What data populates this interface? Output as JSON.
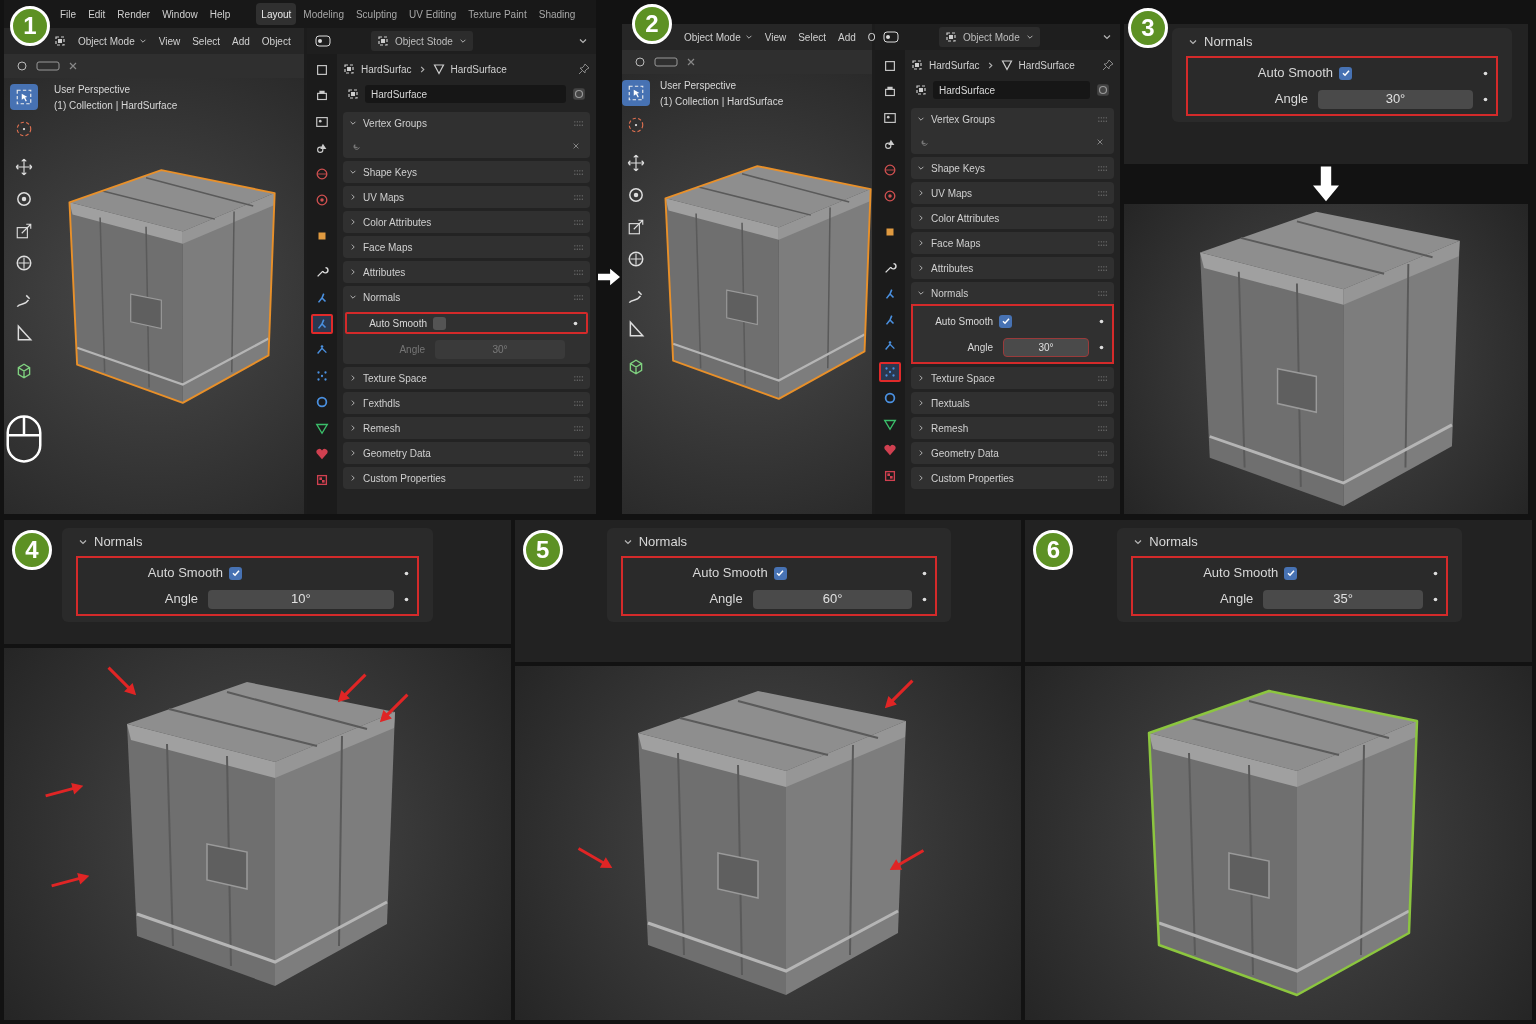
{
  "steps": [
    {
      "kind": "editor",
      "badge": "1",
      "transition_arrow": true,
      "menu": [
        "File",
        "Edit",
        "Render",
        "Window",
        "Help"
      ],
      "workspaces": [
        {
          "label": "Layout",
          "selected": true
        },
        {
          "label": "Modeling",
          "selected": false
        },
        {
          "label": "Sculpting",
          "selected": false
        },
        {
          "label": "UV Editing",
          "selected": false
        },
        {
          "label": "Texture Paint",
          "selected": false
        },
        {
          "label": "Shading",
          "selected": false
        }
      ],
      "viewport": {
        "header": [
          "Object Mode",
          "View",
          "Select",
          "Add",
          "Object"
        ],
        "overlay": [
          "User Perspective",
          "(1) Collection | HardSurface"
        ],
        "tools": [
          {
            "selected": true
          },
          {
            "selected": false
          },
          {
            "selected": false
          },
          {
            "selected": false
          },
          {
            "selected": false
          },
          {
            "selected": false
          },
          {
            "selected": false
          },
          {
            "selected": false
          },
          {
            "selected": false
          }
        ],
        "selection_outline": {
          "color": "#e8902a"
        },
        "mouse_hint": true
      },
      "properties": {
        "header": "Object Stode",
        "breadcrumb": [
          "HardSurfac",
          "HardSurface"
        ],
        "object_name": "HardSurface",
        "tabs": [
          {
            "selected": false
          },
          {
            "selected": false
          },
          {
            "selected": false
          },
          {
            "selected": false
          },
          {
            "selected": false
          },
          {
            "selected": false
          },
          {
            "selected": false
          },
          {
            "selected": false
          },
          {
            "selected": false
          },
          {
            "selected": true
          },
          {
            "selected": false
          },
          {
            "selected": false
          },
          {
            "selected": false
          },
          {
            "selected": false
          },
          {
            "selected": false
          },
          {
            "selected": false
          }
        ],
        "panels": [
          {
            "kind": "list",
            "label": "Vertex Groups",
            "expanded": true
          },
          {
            "kind": "plain",
            "label": "Shape Keys",
            "expanded": true
          },
          {
            "kind": "plain",
            "label": "UV Maps",
            "expanded": false
          },
          {
            "kind": "plain",
            "label": "Color Attributes",
            "expanded": false
          },
          {
            "kind": "plain",
            "label": "Face Maps",
            "expanded": false
          },
          {
            "kind": "plain",
            "label": "Attributes",
            "expanded": false
          },
          {
            "kind": "normals",
            "label": "Normals",
            "expanded": true,
            "auto_smooth": "Auto Smooth",
            "checked": false,
            "angle_label": "Angle",
            "angle": "30°",
            "highlight": {
              "kind": "row"
            }
          },
          {
            "kind": "plain",
            "label": "Texture Space",
            "expanded": false
          },
          {
            "kind": "plain",
            "label": "Гexthdls",
            "expanded": false
          },
          {
            "kind": "plain",
            "label": "Remesh",
            "expanded": false
          },
          {
            "kind": "plain",
            "label": "Geometry Data",
            "expanded": false
          },
          {
            "kind": "plain",
            "label": "Custom Properties",
            "expanded": false
          }
        ]
      }
    },
    {
      "kind": "editor",
      "badge": "2",
      "viewport": {
        "header": [
          "Object Mode",
          "View",
          "Select",
          "Add",
          "O"
        ],
        "overlay": [
          "User Perspective",
          "(1) Collection | HardSurface"
        ],
        "tools": [
          {
            "selected": true
          },
          {
            "selected": false
          },
          {
            "selected": false
          },
          {
            "selected": false
          },
          {
            "selected": false
          },
          {
            "selected": false
          },
          {
            "selected": false
          },
          {
            "selected": false
          },
          {
            "selected": false
          }
        ],
        "selection_outline": {
          "color": "#e8902a"
        }
      },
      "properties": {
        "header": "Object Mode",
        "breadcrumb": [
          "HardSurfac",
          "HardSurface"
        ],
        "object_name": "HardSurface",
        "tabs": [
          {
            "selected": false
          },
          {
            "selected": false
          },
          {
            "selected": false
          },
          {
            "selected": false
          },
          {
            "selected": false
          },
          {
            "selected": false
          },
          {
            "selected": false
          },
          {
            "selected": false
          },
          {
            "selected": false
          },
          {
            "selected": false
          },
          {
            "selected": false
          },
          {
            "selected": true
          },
          {
            "selected": false
          },
          {
            "selected": false
          },
          {
            "selected": false
          },
          {
            "selected": false
          }
        ],
        "panels": [
          {
            "kind": "list",
            "label": "Vertex Groups",
            "expanded": true
          },
          {
            "kind": "plain",
            "label": "Shape Keys",
            "expanded": true
          },
          {
            "kind": "plain",
            "label": "UV Maps",
            "expanded": false
          },
          {
            "kind": "plain",
            "label": "Color Attributes",
            "expanded": false
          },
          {
            "kind": "plain",
            "label": "Face Maps",
            "expanded": false
          },
          {
            "kind": "plain",
            "label": "Attributes",
            "expanded": false
          },
          {
            "kind": "normals",
            "label": "Normals",
            "expanded": true,
            "auto_smooth": "Auto Smooth",
            "checked": true,
            "angle_label": "Angle",
            "angle": "30°",
            "highlight": {
              "kind": "block"
            }
          },
          {
            "kind": "plain",
            "label": "Texture Space",
            "expanded": false
          },
          {
            "kind": "plain",
            "label": "Пextuals",
            "expanded": false
          },
          {
            "kind": "plain",
            "label": "Remesh",
            "expanded": false
          },
          {
            "kind": "plain",
            "label": "Geometry Data",
            "expanded": false
          },
          {
            "kind": "plain",
            "label": "Custom Properties",
            "expanded": false
          }
        ]
      }
    },
    {
      "kind": "detail",
      "badge": "3",
      "transition_arrow": true,
      "normals": {
        "title": "Normals",
        "expanded": true,
        "auto_smooth": "Auto Smooth",
        "checked": true,
        "angle_label": "Angle",
        "angle": "30°",
        "highlight": {
          "kind": "block"
        }
      }
    },
    {
      "kind": "detail",
      "badge": "4",
      "normals": {
        "title": "Normals",
        "expanded": true,
        "auto_smooth": "Auto Smooth",
        "checked": true,
        "angle_label": "Angle",
        "angle": "10°",
        "highlight": {
          "kind": "block"
        }
      },
      "viewport": {
        "annotation_arrows": true
      }
    },
    {
      "kind": "detail",
      "badge": "5",
      "normals": {
        "title": "Normals",
        "expanded": true,
        "auto_smooth": "Auto Smooth",
        "checked": true,
        "angle_label": "Angle",
        "angle": "60°",
        "highlight": {
          "kind": "block"
        }
      },
      "viewport": {
        "annotation_arrows": true
      }
    },
    {
      "kind": "detail",
      "badge": "6",
      "normals": {
        "title": "Normals",
        "expanded": true,
        "auto_smooth": "Auto Smooth",
        "checked": true,
        "angle_label": "Angle",
        "angle": "35°",
        "highlight": {
          "kind": "block"
        }
      },
      "viewport": {
        "selection_outline": {
          "color": "#8cc63f"
        }
      }
    }
  ]
}
